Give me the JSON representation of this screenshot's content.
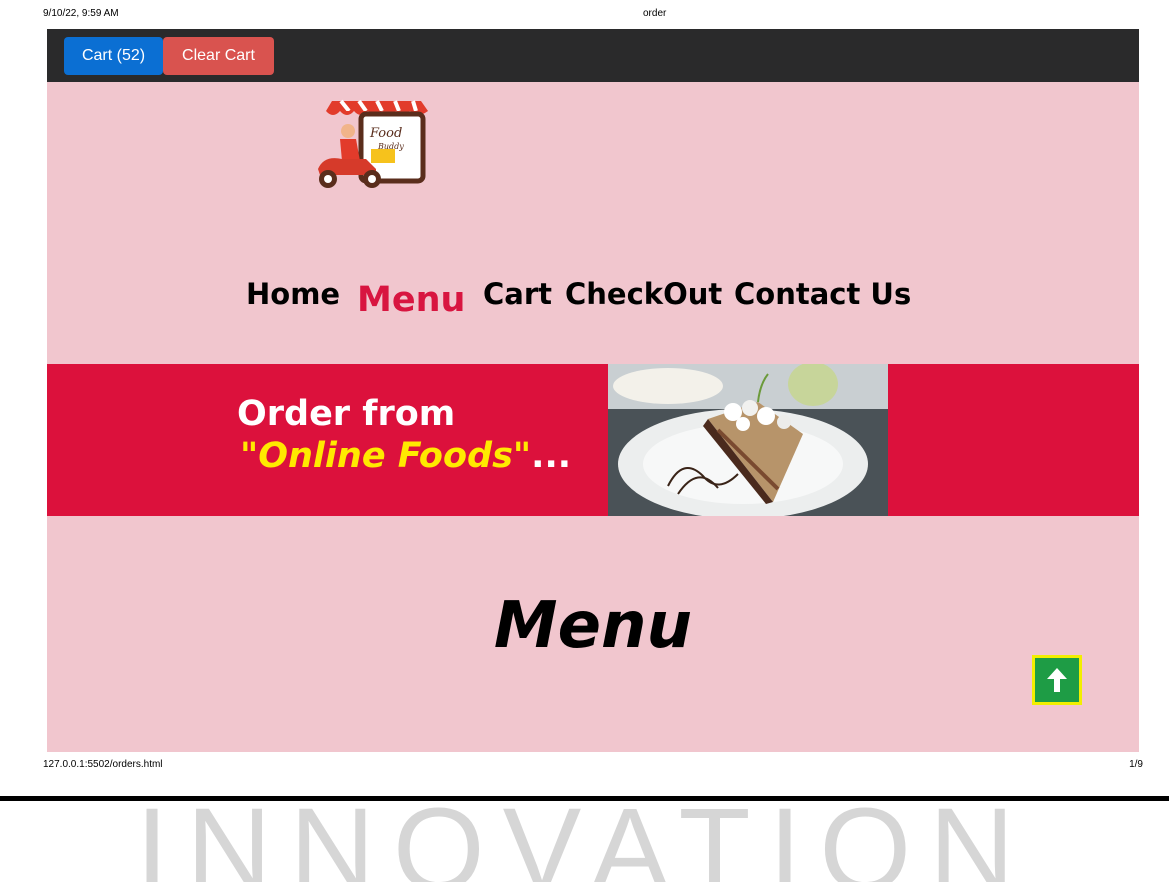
{
  "print_header": {
    "datetime": "9/10/22, 9:59 AM",
    "title": "order"
  },
  "toolbar": {
    "cart_label": "Cart (52)",
    "clear_label": "Clear Cart"
  },
  "logo": {
    "brand_text_1": "Food",
    "brand_text_2": "Buddy"
  },
  "nav": {
    "home": "Home",
    "menu": "Menu",
    "cart": "Cart",
    "checkout": "CheckOut",
    "contact": "Contact Us"
  },
  "banner": {
    "line1": "Order from",
    "line2_quoted": "\"Online Foods\"",
    "line2_suffix": "..."
  },
  "main": {
    "heading": "Menu"
  },
  "scroll_top": {
    "icon": "arrow-up-icon"
  },
  "print_footer": {
    "url": "127.0.0.1:5502/orders.html",
    "page": "1/9"
  },
  "watermark": {
    "text": "INNOVATION"
  },
  "colors": {
    "page_bg": "#f1c6ce",
    "topbar": "#2a2a2b",
    "cart_button": "#0b6fd3",
    "clear_button": "#d9534f",
    "nav_active": "#d81540",
    "banner_bg": "#dc113c",
    "banner_highlight": "#ffea00",
    "scroll_top_bg": "#1e9c45",
    "scroll_top_border": "#f2ef00"
  }
}
